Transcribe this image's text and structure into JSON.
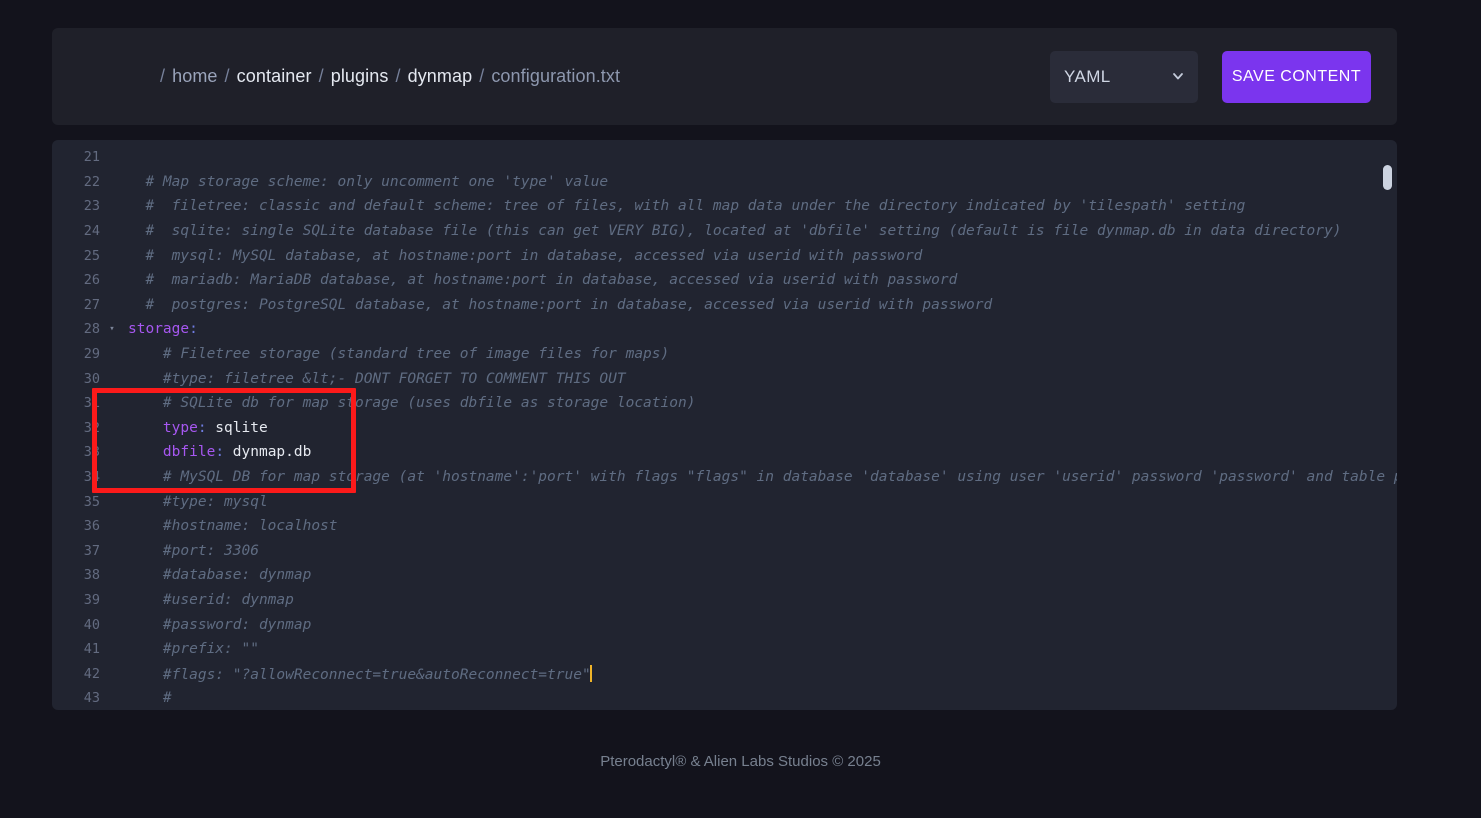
{
  "header": {
    "breadcrumb": {
      "root_separator": "/",
      "separator": "/",
      "items": [
        {
          "label": "home",
          "current": false
        },
        {
          "label": "container",
          "current": false
        },
        {
          "label": "plugins",
          "current": false
        },
        {
          "label": "dynmap",
          "current": false
        },
        {
          "label": "configuration.txt",
          "current": true
        }
      ]
    },
    "language_select": {
      "value": "YAML",
      "icon": "chevron-down-icon"
    },
    "save_button": {
      "label": "SAVE CONTENT",
      "color": "#7b35ee"
    }
  },
  "editor": {
    "first_line_number": 21,
    "scrollbar": {
      "thumb_color": "#ccd3e0"
    },
    "cursor_line": 42,
    "lines": [
      {
        "n": 21,
        "fold": "",
        "segments": []
      },
      {
        "n": 22,
        "fold": "",
        "segments": [
          {
            "t": "comment",
            "s": "  # Map storage scheme: only uncomment one 'type' value"
          }
        ]
      },
      {
        "n": 23,
        "fold": "",
        "segments": [
          {
            "t": "comment",
            "s": "  #  filetree: classic and default scheme: tree of files, with all map data under the directory indicated by 'tilespath' setting"
          }
        ]
      },
      {
        "n": 24,
        "fold": "",
        "segments": [
          {
            "t": "comment",
            "s": "  #  sqlite: single SQLite database file (this can get VERY BIG), located at 'dbfile' setting (default is file dynmap.db in data directory)"
          }
        ]
      },
      {
        "n": 25,
        "fold": "",
        "segments": [
          {
            "t": "comment",
            "s": "  #  mysql: MySQL database, at hostname:port in database, accessed via userid with password"
          }
        ]
      },
      {
        "n": 26,
        "fold": "",
        "segments": [
          {
            "t": "comment",
            "s": "  #  mariadb: MariaDB database, at hostname:port in database, accessed via userid with password"
          }
        ]
      },
      {
        "n": 27,
        "fold": "",
        "segments": [
          {
            "t": "comment",
            "s": "  #  postgres: PostgreSQL database, at hostname:port in database, accessed via userid with password"
          }
        ]
      },
      {
        "n": 28,
        "fold": "▾",
        "segments": [
          {
            "t": "toplevel",
            "s": "storage"
          },
          {
            "t": "colon",
            "s": ":"
          }
        ]
      },
      {
        "n": 29,
        "fold": "",
        "segments": [
          {
            "t": "comment",
            "s": "    # Filetree storage (standard tree of image files for maps)"
          }
        ]
      },
      {
        "n": 30,
        "fold": "",
        "segments": [
          {
            "t": "comment",
            "s": "    #type: filetree &lt;- DONT FORGET TO COMMENT THIS OUT"
          }
        ]
      },
      {
        "n": 31,
        "fold": "",
        "segments": [
          {
            "t": "comment",
            "s": "    # SQLite db for map storage (uses dbfile as storage location)"
          }
        ]
      },
      {
        "n": 32,
        "fold": "",
        "segments": [
          {
            "t": "plain",
            "s": "    "
          },
          {
            "t": "key",
            "s": "type"
          },
          {
            "t": "colon",
            "s": ":"
          },
          {
            "t": "value",
            "s": " sqlite"
          }
        ]
      },
      {
        "n": 33,
        "fold": "",
        "segments": [
          {
            "t": "plain",
            "s": "    "
          },
          {
            "t": "key",
            "s": "dbfile"
          },
          {
            "t": "colon",
            "s": ":"
          },
          {
            "t": "value",
            "s": " dynmap.db"
          }
        ]
      },
      {
        "n": 34,
        "fold": "",
        "segments": [
          {
            "t": "comment",
            "s": "    # MySQL DB for map storage (at 'hostname':'port' with flags \"flags\" in database 'database' using user 'userid' password 'password' and table prefix 'prefix')"
          }
        ]
      },
      {
        "n": 35,
        "fold": "",
        "segments": [
          {
            "t": "comment",
            "s": "    #type: mysql"
          }
        ]
      },
      {
        "n": 36,
        "fold": "",
        "segments": [
          {
            "t": "comment",
            "s": "    #hostname: localhost"
          }
        ]
      },
      {
        "n": 37,
        "fold": "",
        "segments": [
          {
            "t": "comment",
            "s": "    #port: 3306"
          }
        ]
      },
      {
        "n": 38,
        "fold": "",
        "segments": [
          {
            "t": "comment",
            "s": "    #database: dynmap"
          }
        ]
      },
      {
        "n": 39,
        "fold": "",
        "segments": [
          {
            "t": "comment",
            "s": "    #userid: dynmap"
          }
        ]
      },
      {
        "n": 40,
        "fold": "",
        "segments": [
          {
            "t": "comment",
            "s": "    #password: dynmap"
          }
        ]
      },
      {
        "n": 41,
        "fold": "",
        "segments": [
          {
            "t": "comment",
            "s": "    #prefix: \"\""
          }
        ]
      },
      {
        "n": 42,
        "fold": "",
        "segments": [
          {
            "t": "comment",
            "s": "    #flags: \"?allowReconnect=true&autoReconnect=true\""
          },
          {
            "t": "caret",
            "s": ""
          }
        ]
      },
      {
        "n": 43,
        "fold": "",
        "segments": [
          {
            "t": "comment",
            "s": "    #"
          }
        ]
      }
    ]
  },
  "annotation": {
    "color": "#fc1a1a",
    "covers_lines": [
      31,
      32,
      33,
      34
    ]
  },
  "footer": {
    "text": "Pterodactyl® & Alien Labs Studios © 2025"
  }
}
